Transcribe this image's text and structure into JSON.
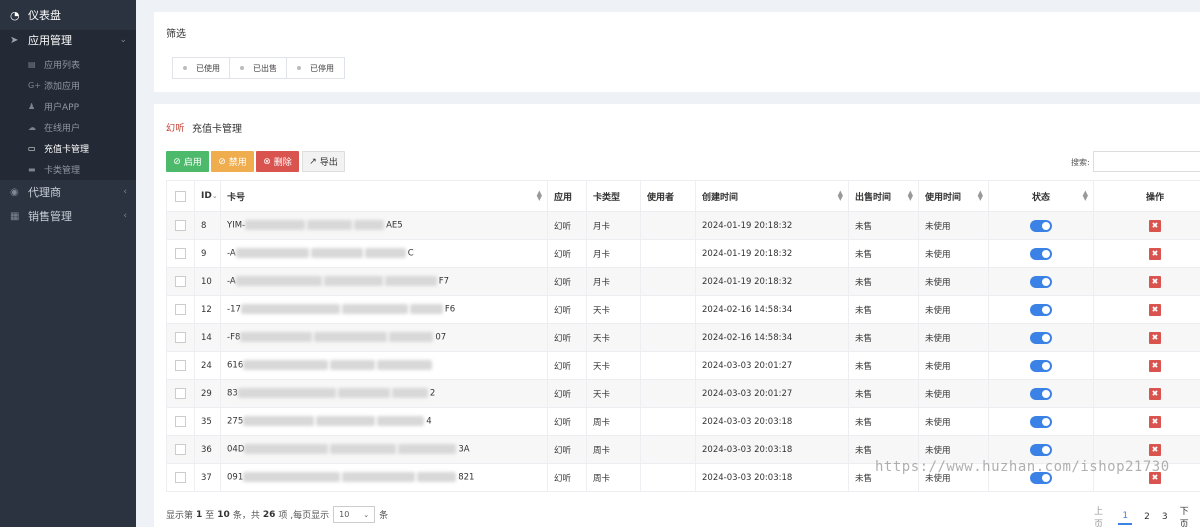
{
  "sidebar": {
    "dashboard": "仪表盘",
    "app_mgmt": "应用管理",
    "app_items": [
      {
        "label": "应用列表",
        "icon": "list-icon",
        "glyph": "▤"
      },
      {
        "label": "添加应用",
        "icon": "google-plus-icon",
        "glyph": "G+"
      },
      {
        "label": "用户APP",
        "icon": "user-icon",
        "glyph": "👤"
      },
      {
        "label": "在线用户",
        "icon": "cloud-icon",
        "glyph": "☁"
      },
      {
        "label": "充值卡管理",
        "icon": "card-icon",
        "glyph": "▭"
      },
      {
        "label": "卡类管理",
        "icon": "card-type-icon",
        "glyph": "▬"
      }
    ],
    "agent": "代理商",
    "sales": "销售管理"
  },
  "filter_panel": {
    "title": "筛选",
    "filters": [
      "已使用",
      "已出售",
      "已停用"
    ]
  },
  "card_panel": {
    "logo_text": "幻听",
    "title": "充值卡管理",
    "buttons": {
      "enable": "启用",
      "disable": "禁用",
      "delete": "删除",
      "export": "导出"
    },
    "search_label": "搜索:"
  },
  "table": {
    "headers": {
      "id": "ID",
      "card_no": "卡号",
      "app": "应用",
      "card_type": "卡类型",
      "user": "使用者",
      "created": "创建时间",
      "sold_time": "出售时间",
      "used_time": "使用时间",
      "status": "状态",
      "action": "操作"
    },
    "rows": [
      {
        "id": "8",
        "card_head": "YIM-",
        "card_tail": "AE5",
        "app": "幻听",
        "type": "月卡",
        "user": "",
        "created": "2024-01-19 20:18:32",
        "sold": "未售",
        "used": "未使用"
      },
      {
        "id": "9",
        "card_head": "-A",
        "card_tail": "C",
        "app": "幻听",
        "type": "月卡",
        "user": "",
        "created": "2024-01-19 20:18:32",
        "sold": "未售",
        "used": "未使用"
      },
      {
        "id": "10",
        "card_head": "-A",
        "card_tail": "F7",
        "app": "幻听",
        "type": "月卡",
        "user": "",
        "created": "2024-01-19 20:18:32",
        "sold": "未售",
        "used": "未使用"
      },
      {
        "id": "12",
        "card_head": "-17",
        "card_tail": "F6",
        "app": "幻听",
        "type": "天卡",
        "user": "",
        "created": "2024-02-16 14:58:34",
        "sold": "未售",
        "used": "未使用"
      },
      {
        "id": "14",
        "card_head": "-F8",
        "card_tail": "07",
        "app": "幻听",
        "type": "天卡",
        "user": "",
        "created": "2024-02-16 14:58:34",
        "sold": "未售",
        "used": "未使用"
      },
      {
        "id": "24",
        "card_head": "616",
        "card_tail": "",
        "app": "幻听",
        "type": "天卡",
        "user": "",
        "created": "2024-03-03 20:01:27",
        "sold": "未售",
        "used": "未使用"
      },
      {
        "id": "29",
        "card_head": "83",
        "card_tail": "2",
        "app": "幻听",
        "type": "天卡",
        "user": "",
        "created": "2024-03-03 20:01:27",
        "sold": "未售",
        "used": "未使用"
      },
      {
        "id": "35",
        "card_head": "275",
        "card_tail": "4",
        "app": "幻听",
        "type": "周卡",
        "user": "",
        "created": "2024-03-03 20:03:18",
        "sold": "未售",
        "used": "未使用"
      },
      {
        "id": "36",
        "card_head": "04D",
        "card_tail": "3A",
        "app": "幻听",
        "type": "周卡",
        "user": "",
        "created": "2024-03-03 20:03:18",
        "sold": "未售",
        "used": "未使用"
      },
      {
        "id": "37",
        "card_head": "091",
        "card_tail": "821",
        "app": "幻听",
        "type": "周卡",
        "user": "",
        "created": "2024-03-03 20:03:18",
        "sold": "未售",
        "used": "未使用"
      }
    ]
  },
  "pagination": {
    "info_prefix": "显示第",
    "from": "1",
    "to_word": "至",
    "to": "10",
    "mid": "条，共",
    "total": "26",
    "suffix": "项 ,每页显示",
    "page_size": "10",
    "unit": "条",
    "prev": "上页",
    "pages": [
      "1",
      "2",
      "3"
    ],
    "next": "下页"
  },
  "watermark": "https://www.huzhan.com/ishop21730",
  "colors": {
    "sidebar_bg": "#2b3340",
    "enable": "#4cba6a",
    "disable": "#f0ad4e",
    "delete": "#d9534f",
    "toggle_on": "#3b82e6"
  }
}
